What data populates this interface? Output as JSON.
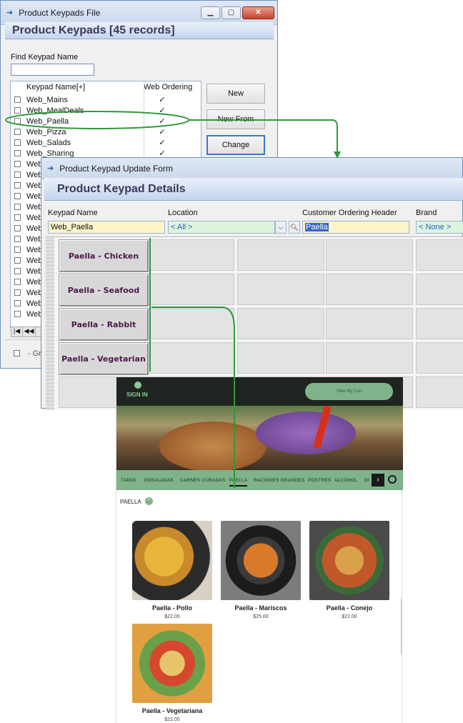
{
  "window1": {
    "title": "Product Keypads File",
    "header": "Product Keypads [45 records]",
    "find_label": "Find Keypad Name",
    "find_value": "",
    "columns": [
      "Keypad Name[+]",
      "Web Ordering"
    ],
    "rows": [
      {
        "name": "Web_Mains",
        "web": "✓"
      },
      {
        "name": "Web_MealDeals",
        "web": "✓"
      },
      {
        "name": "Web_Paella",
        "web": "✓"
      },
      {
        "name": "Web_Pizza",
        "web": "✓"
      },
      {
        "name": "Web_Salads",
        "web": "✓"
      },
      {
        "name": "Web_Sharing",
        "web": "✓"
      },
      {
        "name": "Web",
        "web": ""
      },
      {
        "name": "Web",
        "web": ""
      },
      {
        "name": "Web",
        "web": ""
      },
      {
        "name": "Web",
        "web": ""
      },
      {
        "name": "Web",
        "web": ""
      },
      {
        "name": "Web",
        "web": ""
      },
      {
        "name": "Web",
        "web": ""
      },
      {
        "name": "Web",
        "web": ""
      },
      {
        "name": "Web",
        "web": ""
      },
      {
        "name": "Web",
        "web": ""
      },
      {
        "name": "Web",
        "web": ""
      },
      {
        "name": "Web",
        "web": ""
      },
      {
        "name": "Web",
        "web": ""
      },
      {
        "name": "Web",
        "web": ""
      },
      {
        "name": "Web",
        "web": ""
      }
    ],
    "buttons": {
      "new": "New",
      "new_from": "New From",
      "change": "Change"
    },
    "nav": {
      "first": "|◀",
      "prev": "◀◀"
    },
    "footer_label": "- Gra"
  },
  "window2": {
    "title": "Product Keypad Update Form",
    "header": "Product Keypad Details",
    "labels": {
      "keypad_name": "Keypad Name",
      "location": "Location",
      "customer_header": "Customer Ordering Header",
      "brand": "Brand"
    },
    "values": {
      "keypad_name": "Web_Paella",
      "location": "< All >",
      "customer_header": "Paella",
      "brand": "< None >"
    },
    "keys": [
      "Paella - Chicken",
      "Paella - Seafood",
      "Paella - Rabbit",
      "Paella - Vegetarian"
    ]
  },
  "web": {
    "sign_in": "SIGN IN",
    "cart_button": "View My Cart",
    "categories": [
      "TAPAS",
      "ENSALADAS",
      "CARNES CURADAS",
      "PAELLA",
      "RACIONES GRANDES",
      "POSTRES",
      "ALCOHOL",
      "DI"
    ],
    "section_title": "PAELLA",
    "products": [
      {
        "name": "Paella - Pollo",
        "price": "$22.00"
      },
      {
        "name": "Paella - Mariscos",
        "price": "$25.00"
      },
      {
        "name": "Paella - Conejo",
        "price": "$22.00"
      },
      {
        "name": "Paella - Vegetariana",
        "price": "$22.00"
      }
    ]
  },
  "colors": {
    "brand_green": "#7fb38a",
    "dark_bar": "#1f2420",
    "arrow": "#2e9a3a",
    "key_text": "#4b1a4b"
  }
}
